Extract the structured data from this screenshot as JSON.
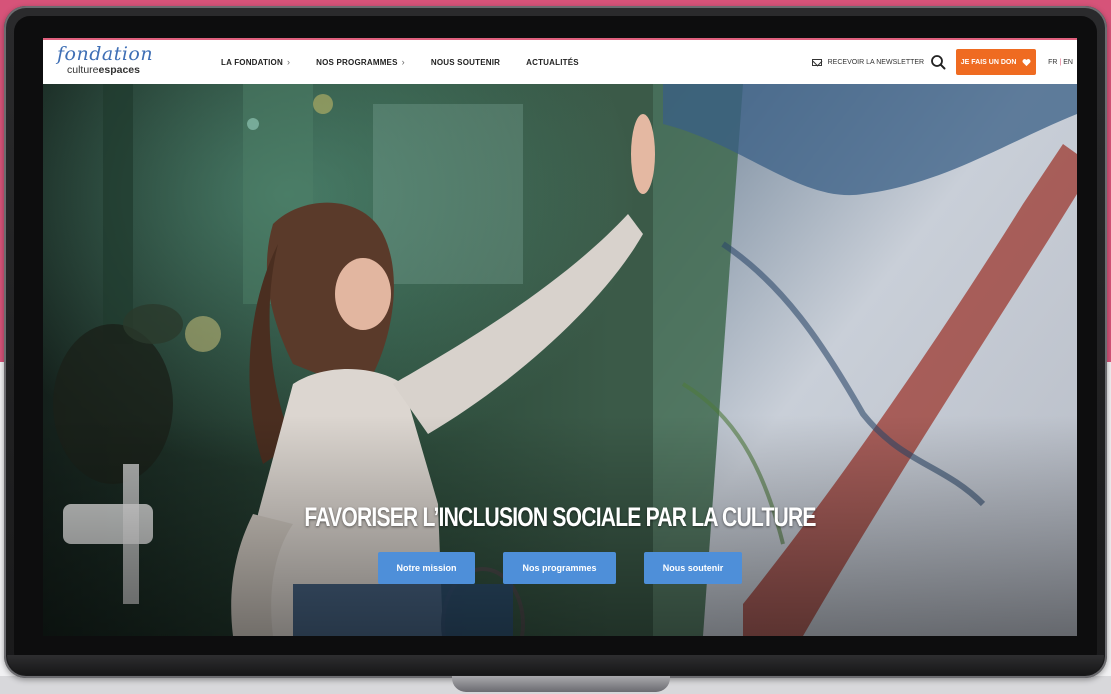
{
  "colors": {
    "brand_pink": "#d65379",
    "donate_orange": "#ef6b21",
    "cta_blue": "#4e8fd9",
    "logo_blue": "#3f6fb5"
  },
  "header": {
    "logo": {
      "script": "fondation",
      "sub_light": "culture",
      "sub_bold": "espaces"
    },
    "nav": [
      {
        "label": "LA FONDATION",
        "has_chevron": true,
        "chevron": "›"
      },
      {
        "label": "NOS PROGRAMMES",
        "has_chevron": true,
        "chevron": "›"
      },
      {
        "label": "NOUS SOUTENIR",
        "has_chevron": false
      },
      {
        "label": "ACTUALITÉS",
        "has_chevron": false
      }
    ],
    "newsletter_label": "RECEVOIR LA NEWSLETTER",
    "donate_label": "JE FAIS UN DON",
    "lang": {
      "fr": "FR",
      "separator": "|",
      "en": "EN"
    }
  },
  "hero": {
    "title": "FAVORISER L’INCLUSION SOCIALE PAR LA CULTURE",
    "buttons": [
      "Notre mission",
      "Nos programmes",
      "Nous soutenir"
    ]
  },
  "icons": [
    "mail-icon",
    "search-icon",
    "heart-icon",
    "chevron-right-icon"
  ]
}
